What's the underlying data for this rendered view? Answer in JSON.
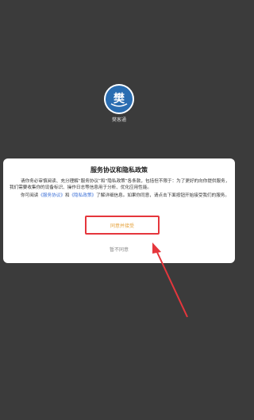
{
  "app": {
    "name": "樊客通",
    "icon": "fan-logo-icon"
  },
  "dialog": {
    "title": "服务协议和隐私政策",
    "paragraph1": "请你务必审慎阅读、充分理解“服务协议”和“隐私政策”各条款，包括但不限于：为了更好的向你提供服务，我们需要收集你的设备标识、操作日志等信息用于分析、优化应用性能。",
    "p2_before": "你可阅读",
    "p2_link1": "《服务协议》",
    "p2_mid": "和",
    "p2_link2": "《隐私政策》",
    "p2_after": "了解详细信息。如果你同意，请点击下面按钮开始接受我们的服务。",
    "agree_label": "同意并接受",
    "disagree_label": "暂不同意"
  },
  "colors": {
    "overlay": "#3b3b3b",
    "link": "#3b6fd6",
    "highlight": "#e5363c",
    "agree_text": "#e5a23a"
  }
}
